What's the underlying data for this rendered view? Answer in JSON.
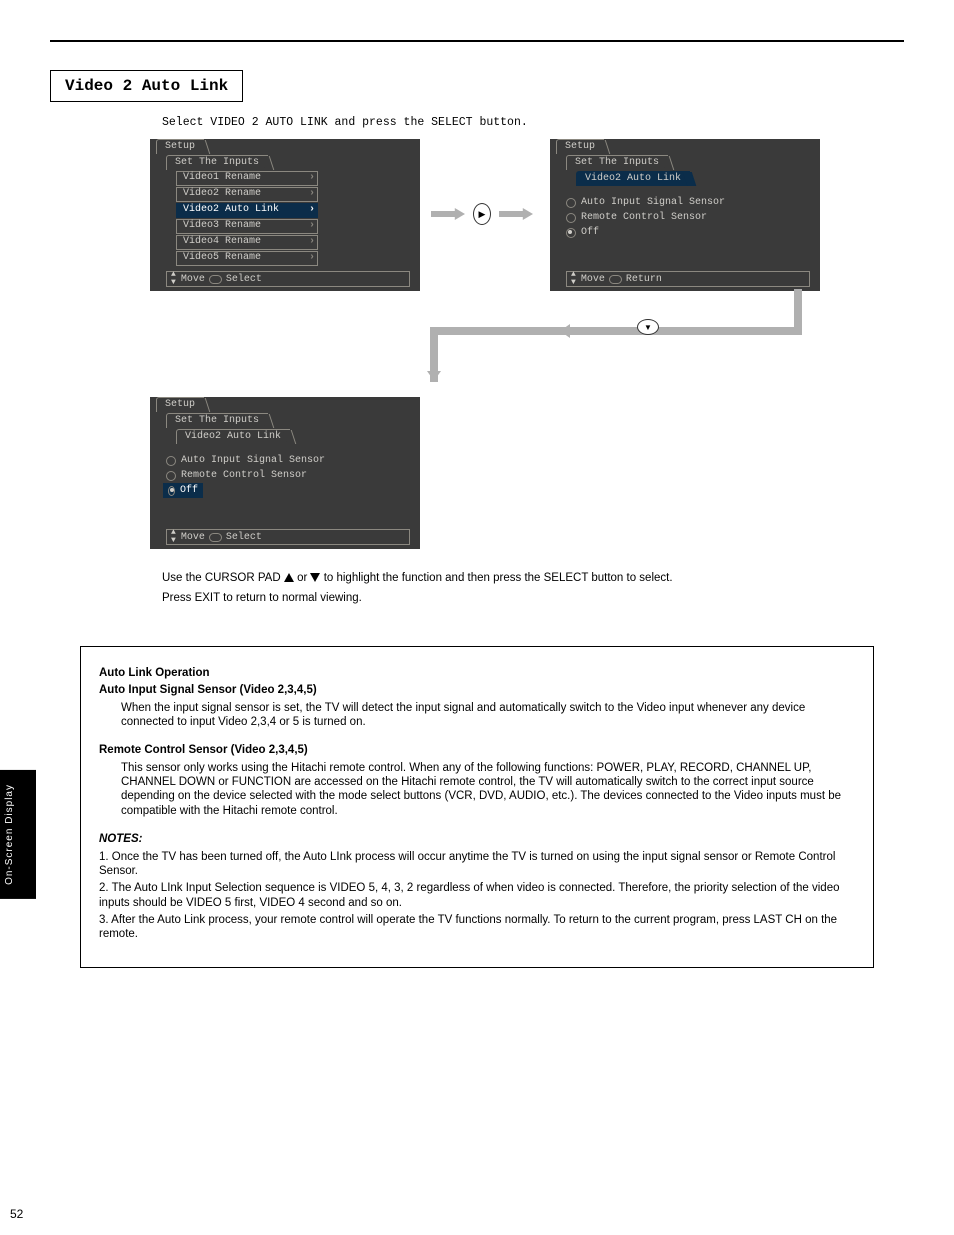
{
  "heading": "Video 2 Auto Link",
  "instr1": "Select VIDEO 2 AUTO LINK and press the SELECT button.",
  "osd": {
    "tab_setup": "Setup",
    "tab_inputs": "Set The Inputs",
    "tab_v2auto": "Video2 Auto Link",
    "rows": {
      "v1r": "Video1 Rename",
      "v2r": "Video2 Rename",
      "v2al": "Video2 Auto Link",
      "v3r": "Video3 Rename",
      "v4r": "Video4 Rename",
      "v5r": "Video5 Rename"
    },
    "opts": {
      "ais": "Auto Input Signal Sensor",
      "rcs": "Remote Control Sensor",
      "off": "Off"
    },
    "footer": {
      "move": "Move",
      "select": "Select",
      "return": "Return"
    }
  },
  "para": {
    "l1a": "Use the CURSOR PAD ",
    "l1b": " or ",
    "l1c": " to highlight the function and then press the SELECT button to select.",
    "l2": "Press EXIT to return to normal viewing."
  },
  "inset": {
    "title": "Auto Link Operation",
    "ais_hdr": "Auto Input Signal Sensor (Video 2,3,4,5)",
    "ais_body": "When the input signal sensor is set, the TV will detect the input signal and automatically switch to the Video input whenever any device connected to input Video 2,3,4 or 5 is turned on.",
    "rcs_hdr": "Remote Control Sensor (Video 2,3,4,5)",
    "rcs_body": "This sensor only works using the Hitachi remote control. When any of the following functions: POWER, PLAY, RECORD, CHANNEL UP, CHANNEL DOWN or FUNCTION are accessed on the Hitachi remote control, the TV will automatically switch to the correct input source depending on the device selected with the mode select buttons (VCR, DVD, AUDIO, etc.). The devices connected to the Video inputs must be compatible with the Hitachi remote control.",
    "notes_hdr": "NOTES:",
    "n1": "1.  Once the TV has been turned off, the Auto LInk process will occur anytime the TV is turned on using the input signal sensor or Remote Control Sensor.",
    "n2": "2.  The Auto LInk Input Selection sequence is VIDEO 5, 4, 3, 2 regardless of when video is connected. Therefore, the priority selection of the video inputs should be VIDEO 5 first, VIDEO 4 second and so on.",
    "n3": "3.  After the Auto Link process, your remote control will operate the TV functions normally. To return to the current program, press LAST CH on the remote."
  },
  "side_label": "On-Screen Display",
  "page_number": "52"
}
